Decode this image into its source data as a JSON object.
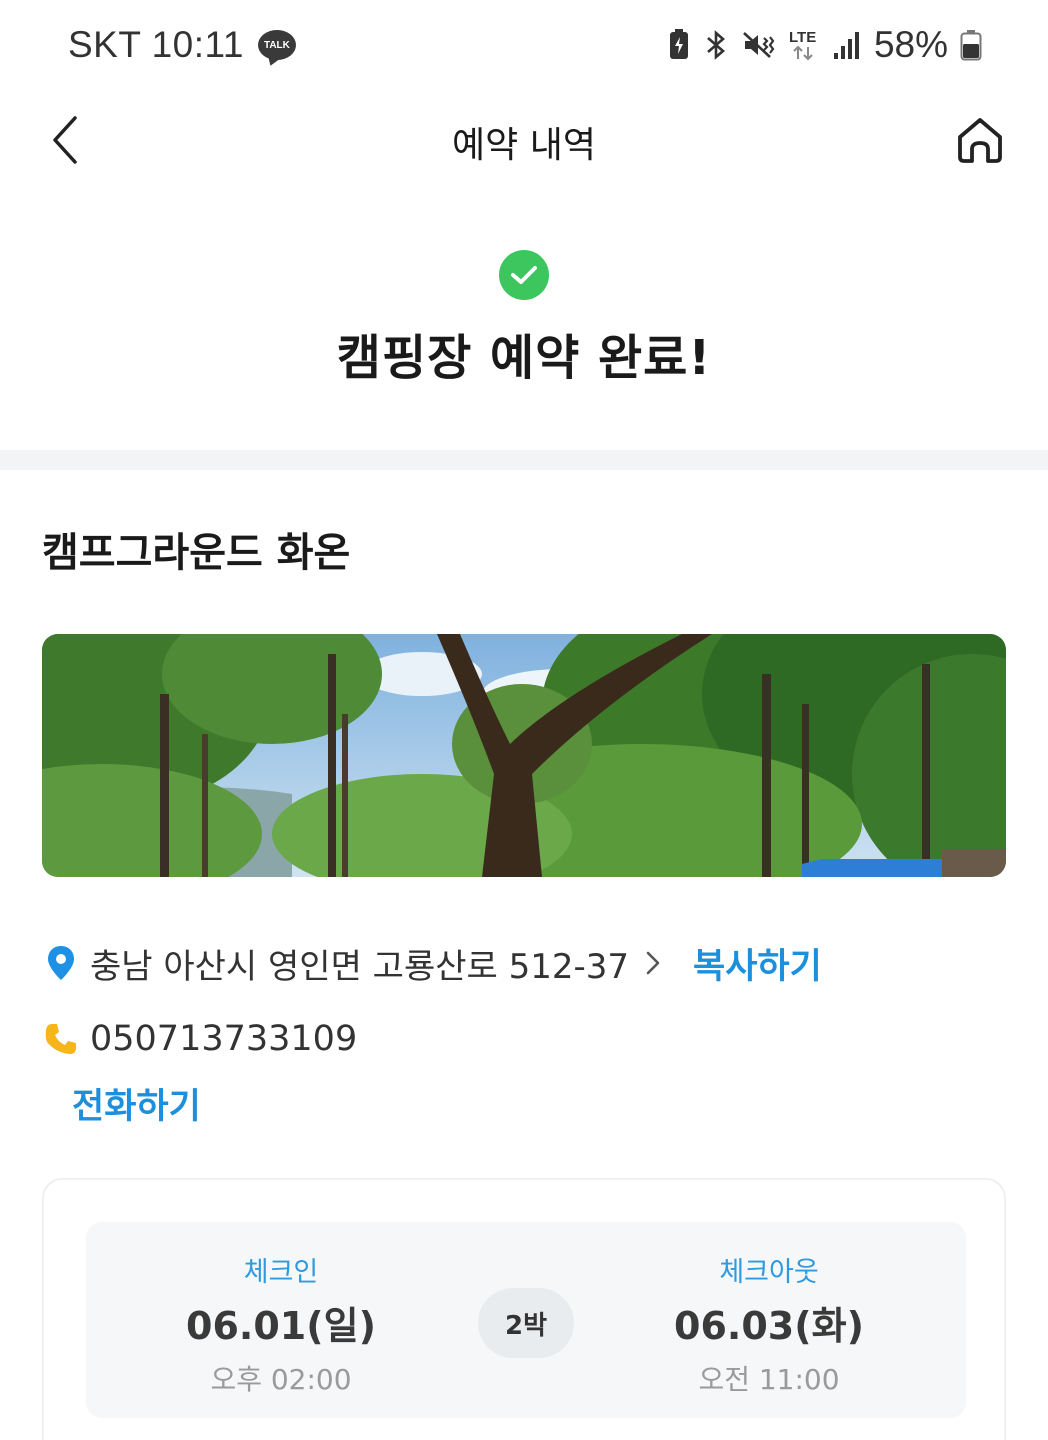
{
  "status_bar": {
    "carrier_time": "SKT 10:11",
    "talk_badge": "TALK",
    "network": "LTE",
    "battery": "58%",
    "icons": [
      "battery-saver-icon",
      "bluetooth-icon",
      "mute-vibrate-icon",
      "lte-icon",
      "signal-icon",
      "battery-icon"
    ]
  },
  "header": {
    "title": "예약 내역",
    "back_icon": "chevron-left-icon",
    "home_icon": "home-icon"
  },
  "success": {
    "title": "캠핑장 예약 완료!",
    "icon": "check-circle-icon",
    "accent_color": "#3dc65d"
  },
  "campsite": {
    "name": "캠프그라운드 화온",
    "photo_subject": "forest campsite",
    "address": "충남 아산시 영인면 고룡산로 512-37",
    "copy_label": "복사하기",
    "phone": "050713733109",
    "call_label": "전화하기",
    "link_color": "#1d8fdb"
  },
  "booking": {
    "checkin": {
      "label": "체크인",
      "date": "06.01(일)",
      "time": "오후 02:00"
    },
    "nights": "2박",
    "checkout": {
      "label": "체크아웃",
      "date": "06.03(화)",
      "time": "오전 11:00"
    }
  }
}
